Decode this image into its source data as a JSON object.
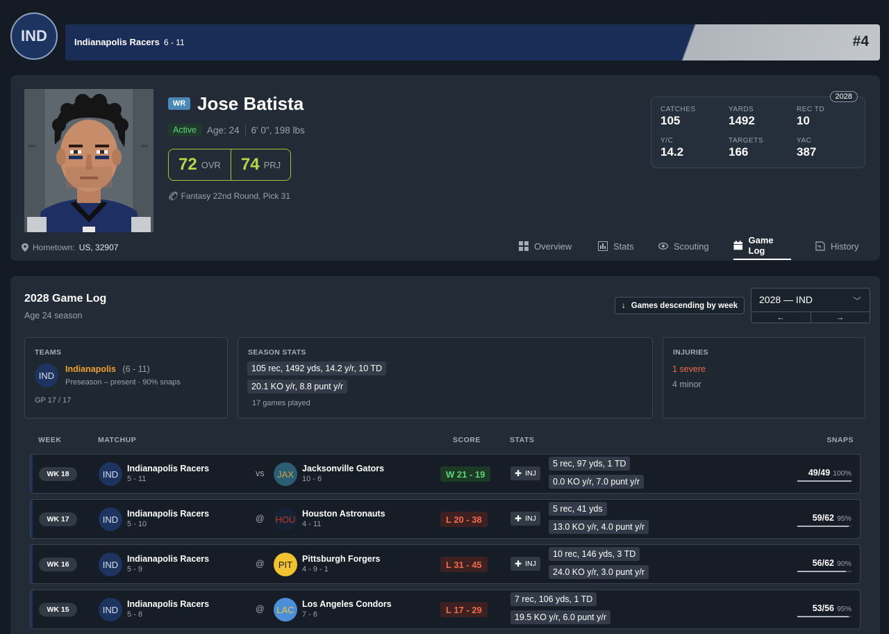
{
  "team": {
    "abbr": "IND",
    "name": "Indianapolis Racers",
    "record": "6 - 11",
    "rank": "#4",
    "color": "#1d3461"
  },
  "player": {
    "position": "WR",
    "name": "Jose Batista",
    "status": "Active",
    "age": "Age: 24",
    "size": "6' 0\", 198 lbs",
    "ovr": "72",
    "ovr_label": "OVR",
    "prj": "74",
    "prj_label": "PRJ",
    "draft": "Fantasy 22nd Round, Pick 31",
    "hometown_label": "Hometown:",
    "hometown": "US, 32907"
  },
  "season_box": {
    "year": "2028",
    "stats": [
      {
        "label": "CATCHES",
        "value": "105"
      },
      {
        "label": "YARDS",
        "value": "1492"
      },
      {
        "label": "REC TD",
        "value": "10"
      },
      {
        "label": "Y/C",
        "value": "14.2"
      },
      {
        "label": "TARGETS",
        "value": "166"
      },
      {
        "label": "YAC",
        "value": "387"
      }
    ]
  },
  "tabs": [
    "Overview",
    "Stats",
    "Scouting",
    "Game Log",
    "History"
  ],
  "log": {
    "title": "2028 Game Log",
    "subtitle": "Age 24 season",
    "sort_label": "Games descending by week",
    "season_value": "2028 — IND",
    "prev": "←",
    "next": "→",
    "teams": {
      "header": "TEAMS",
      "abbr": "IND",
      "name": "Indianapolis",
      "record": "(6 - 11)",
      "span": "Preseason – present · 90% snaps",
      "gp": "GP 17 / 17"
    },
    "season_stats": {
      "header": "SEASON STATS",
      "line1": "105 rec, 1492 yds, 14.2 y/r, 10 TD",
      "line2": "20.1 KO y/r, 8.8 punt y/r",
      "games": "17 games played"
    },
    "injuries": {
      "header": "INJURIES",
      "severe": "1 severe",
      "minor": "4 minor"
    },
    "columns": {
      "week": "WEEK",
      "matchup": "MATCHUP",
      "score": "SCORE",
      "stats": "STATS",
      "snaps": "SNAPS"
    },
    "games": [
      {
        "week": "WK 18",
        "home": "Indianapolis Racers",
        "home_rec": "5 - 11",
        "sep": "vs",
        "opp_abbr": "JAX",
        "opp": "Jacksonville Gators",
        "opp_rec": "10 - 6",
        "opp_bg": "#2b5d73",
        "opp_fg": "#c9a24a",
        "result": "w",
        "score": "W 21 - 19",
        "inj": "INJ",
        "line1": "5 rec, 97 yds, 1 TD",
        "line2": "0.0 KO y/r, 7.0 punt y/r",
        "snaps": "49/49",
        "pct": "100%",
        "snap_frac": 1.0
      },
      {
        "week": "WK 17",
        "home": "Indianapolis Racers",
        "home_rec": "5 - 10",
        "sep": "@",
        "opp_abbr": "HOU",
        "opp": "Houston Astronauts",
        "opp_rec": "4 - 11",
        "opp_bg": "#162234",
        "opp_fg": "#c0392b",
        "result": "l",
        "score": "L 20 - 38",
        "inj": "INJ",
        "line1": "5 rec, 41 yds",
        "line2": "13.0 KO y/r, 4.0 punt y/r",
        "snaps": "59/62",
        "pct": "95%",
        "snap_frac": 0.95
      },
      {
        "week": "WK 16",
        "home": "Indianapolis Racers",
        "home_rec": "5 - 9",
        "sep": "@",
        "opp_abbr": "PIT",
        "opp": "Pittsburgh Forgers",
        "opp_rec": "4 - 9 - 1",
        "opp_bg": "#f2c230",
        "opp_fg": "#1a1a1a",
        "result": "l",
        "score": "L 31 - 45",
        "inj": "INJ",
        "line1": "10 rec, 146 yds, 3 TD",
        "line2": "24.0 KO y/r, 3.0 punt y/r",
        "snaps": "56/62",
        "pct": "90%",
        "snap_frac": 0.9
      },
      {
        "week": "WK 15",
        "home": "Indianapolis Racers",
        "home_rec": "5 - 8",
        "sep": "@",
        "opp_abbr": "LAC",
        "opp": "Los Angeles Condors",
        "opp_rec": "7 - 6",
        "opp_bg": "#4a8fd8",
        "opp_fg": "#f5c542",
        "result": "l",
        "score": "L 17 - 29",
        "inj": "",
        "line1": "7 rec, 106 yds, 1 TD",
        "line2": "19.5 KO y/r, 6.0 punt y/r",
        "snaps": "53/56",
        "pct": "95%",
        "snap_frac": 0.95
      }
    ]
  }
}
